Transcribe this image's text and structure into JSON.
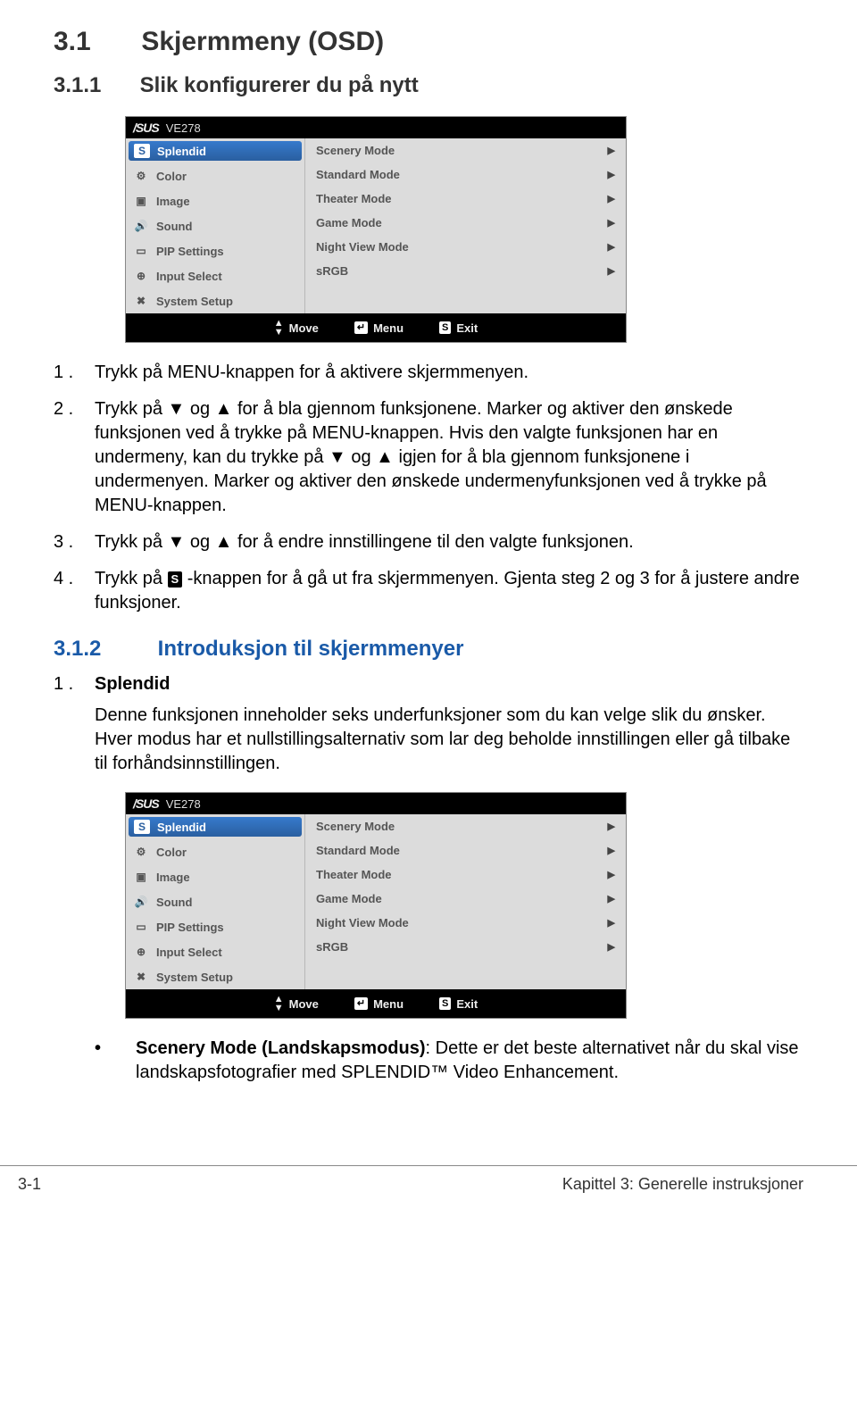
{
  "headings": {
    "h1_num": "3.1",
    "h1_text": "Skjermmeny (OSD)",
    "h2_num": "3.1.1",
    "h2_text": "Slik konfigurerer du på nytt",
    "h3_num": "3.1.2",
    "h3_text": "Introduksjon til skjermmenyer"
  },
  "osd": {
    "brand": "/SUS",
    "model": "VE278",
    "left_items": [
      {
        "icon": "S",
        "label": "Splendid",
        "selected": true
      },
      {
        "icon": "⚙",
        "label": "Color"
      },
      {
        "icon": "▣",
        "label": "Image"
      },
      {
        "icon": "🔊",
        "label": "Sound"
      },
      {
        "icon": "▭",
        "label": "PIP Settings"
      },
      {
        "icon": "⊕",
        "label": "Input Select"
      },
      {
        "icon": "✖",
        "label": "System Setup"
      }
    ],
    "right_items": [
      "Scenery Mode",
      "Standard Mode",
      "Theater Mode",
      "Game Mode",
      "Night View Mode",
      "sRGB"
    ],
    "footer": {
      "move": "Move",
      "menu": "Menu",
      "menu_key": "↵",
      "exit": "Exit",
      "exit_key": "S"
    }
  },
  "steps": {
    "s1": "Trykk på MENU-knappen for å aktivere skjermmenyen.",
    "s2": "Trykk på ▼ og ▲ for å bla gjennom funksjonene. Marker og aktiver den ønskede funksjonen ved å trykke på MENU-knappen. Hvis den valgte funksjonen har en undermeny, kan du trykke på ▼ og ▲ igjen for å bla gjennom funksjonene i undermenyen. Marker og aktiver den ønskede undermenyfunksjonen ved å trykke på MENU-knappen.",
    "s3": "Trykk på ▼ og ▲ for å endre innstillingene til den valgte funksjonen.",
    "s4a": "Trykk på ",
    "s4_key": "S",
    "s4b": " -knappen for å gå ut fra skjermmenyen. Gjenta steg 2 og 3 for å justere andre funksjoner."
  },
  "section312": {
    "item1_title": "Splendid",
    "item1_body": "Denne funksjonen inneholder seks underfunksjoner som du kan velge slik du ønsker. Hver modus har et nullstillingsalternativ som lar deg beholde innstillingen eller gå tilbake til forhåndsinnstillingen."
  },
  "bullets": {
    "b1_strong": "Scenery Mode (Landskapsmodus)",
    "b1_rest": ": Dette er det beste alternativet når du skal vise landskapsfotografier med SPLENDID™ Video Enhancement."
  },
  "footer": {
    "left": "3-1",
    "right": "Kapittel 3: Generelle instruksjoner"
  }
}
